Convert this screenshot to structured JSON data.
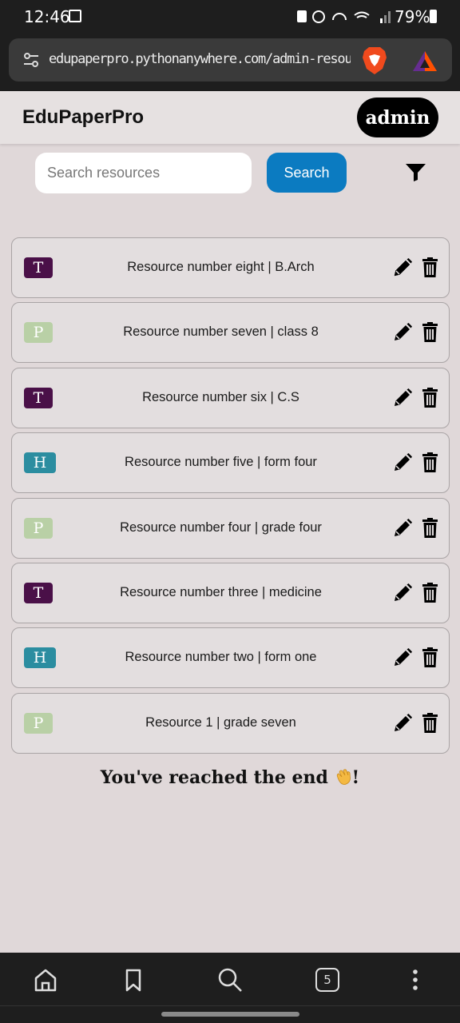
{
  "status_bar": {
    "time": "12:46",
    "battery": "79%"
  },
  "browser": {
    "url": "edupaperpro.pythonanywhere.com/admin-resource",
    "tab_count": "5"
  },
  "header": {
    "brand": "EduPaperPro",
    "user_badge": "admin"
  },
  "search": {
    "placeholder": "Search resources",
    "button_label": "Search"
  },
  "resources": [
    {
      "type": "T",
      "title": "Resource number eight | B.Arch"
    },
    {
      "type": "P",
      "title": "Resource number seven | class 8"
    },
    {
      "type": "T",
      "title": "Resource number six | C.S"
    },
    {
      "type": "H",
      "title": "Resource number five | form four"
    },
    {
      "type": "P",
      "title": "Resource number four | grade four"
    },
    {
      "type": "T",
      "title": "Resource number three | medicine"
    },
    {
      "type": "H",
      "title": "Resource number two | form one"
    },
    {
      "type": "P",
      "title": "Resource 1 | grade seven"
    }
  ],
  "end_message": "You've reached the end",
  "end_suffix": "!",
  "colors": {
    "type_T": "#4a1048",
    "type_P": "#b9d0a6",
    "type_H": "#2b8da0",
    "accent": "#0b7bc1"
  }
}
